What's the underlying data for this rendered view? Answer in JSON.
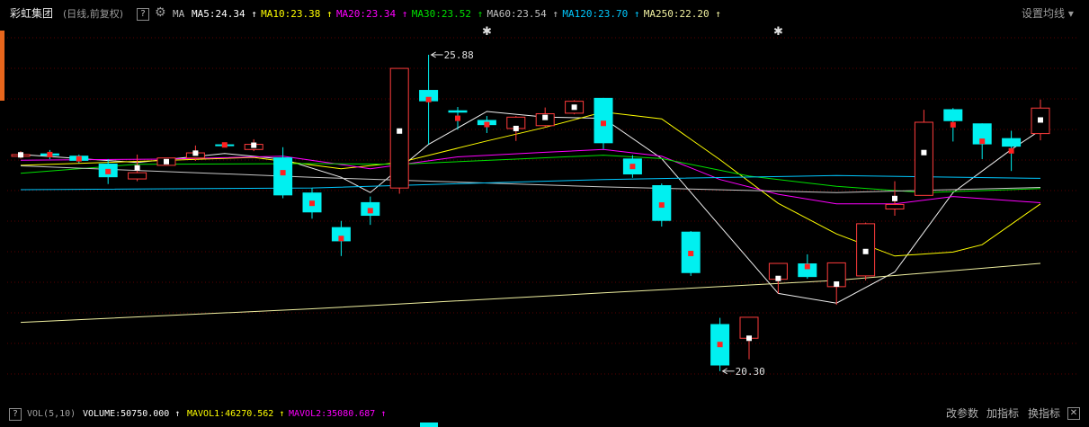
{
  "header": {
    "stock_name": "彩虹集团",
    "period_info": "(日线,前复权)",
    "help_label": "?",
    "ma_label": "MA",
    "settings_label": "设置均线"
  },
  "ma_legend": [
    {
      "text": "MA5:24.34",
      "color": "#ffffff"
    },
    {
      "text": "MA10:23.38",
      "color": "#ffff00"
    },
    {
      "text": "MA20:23.34",
      "color": "#ff00ff"
    },
    {
      "text": "MA30:23.52",
      "color": "#00e000"
    },
    {
      "text": "MA60:23.54",
      "color": "#c0c0c0"
    },
    {
      "text": "MA120:23.70",
      "color": "#00c8ff"
    },
    {
      "text": "MA250:22.20",
      "color": "#f0f0a0"
    }
  ],
  "footer": {
    "help_label": "?",
    "vol_label": "VOL(5,10)",
    "volume_text": "VOLUME:50750.000",
    "mavol1_text": "MAVOL1:46270.562",
    "mavol2_text": "MAVOL2:35080.687",
    "change_params": "改参数",
    "add_indicator": "加指标",
    "switch_indicator": "换指标"
  },
  "chart_data": {
    "type": "candlestick",
    "ylim": [
      19.79,
      26.45
    ],
    "grid": true,
    "colors": {
      "up": "#ff3c3c",
      "down": "#00f0f0",
      "mid_down": "#ff2020",
      "mid_up": "#ffffff"
    },
    "annotations": [
      {
        "label": "25.88",
        "candle_index": 14,
        "price": 25.88,
        "kind": "high"
      },
      {
        "label": "20.30",
        "candle_index": 24,
        "price": 20.3,
        "kind": "low"
      }
    ],
    "star_markers": [
      16,
      26
    ],
    "candles": [
      {
        "o": 24.11,
        "h": 24.18,
        "l": 24.05,
        "c": 24.12
      },
      {
        "o": 24.14,
        "h": 24.2,
        "l": 24.04,
        "c": 24.1
      },
      {
        "o": 24.1,
        "h": 24.12,
        "l": 23.97,
        "c": 24.01
      },
      {
        "o": 23.96,
        "h": 24.04,
        "l": 23.6,
        "c": 23.72
      },
      {
        "o": 23.69,
        "h": 24.12,
        "l": 23.65,
        "c": 23.8
      },
      {
        "o": 23.93,
        "h": 24.06,
        "l": 23.93,
        "c": 24.06
      },
      {
        "o": 24.06,
        "h": 24.28,
        "l": 24.01,
        "c": 24.15
      },
      {
        "o": 24.3,
        "h": 24.33,
        "l": 24.25,
        "c": 24.27
      },
      {
        "o": 24.21,
        "h": 24.39,
        "l": 24.18,
        "c": 24.3
      },
      {
        "o": 24.07,
        "h": 24.25,
        "l": 23.35,
        "c": 23.4
      },
      {
        "o": 23.45,
        "h": 23.53,
        "l": 22.99,
        "c": 23.1
      },
      {
        "o": 22.84,
        "h": 22.95,
        "l": 22.33,
        "c": 22.59
      },
      {
        "o": 23.28,
        "h": 23.38,
        "l": 22.88,
        "c": 23.04
      },
      {
        "o": 23.53,
        "h": 25.64,
        "l": 23.43,
        "c": 25.64
      },
      {
        "o": 25.26,
        "h": 25.88,
        "l": 24.3,
        "c": 25.06
      },
      {
        "o": 24.9,
        "h": 24.96,
        "l": 24.56,
        "c": 24.86
      },
      {
        "o": 24.73,
        "h": 24.8,
        "l": 24.5,
        "c": 24.64
      },
      {
        "o": 24.58,
        "h": 24.8,
        "l": 24.36,
        "c": 24.78
      },
      {
        "o": 24.63,
        "h": 24.95,
        "l": 24.6,
        "c": 24.84
      },
      {
        "o": 24.85,
        "h": 25.08,
        "l": 24.83,
        "c": 25.06
      },
      {
        "o": 25.12,
        "h": 25.12,
        "l": 24.22,
        "c": 24.32
      },
      {
        "o": 24.05,
        "h": 24.11,
        "l": 23.71,
        "c": 23.77
      },
      {
        "o": 23.58,
        "h": 23.61,
        "l": 22.85,
        "c": 22.95
      },
      {
        "o": 22.76,
        "h": 22.77,
        "l": 21.98,
        "c": 22.03
      },
      {
        "o": 21.13,
        "h": 21.24,
        "l": 20.3,
        "c": 20.4
      },
      {
        "o": 20.88,
        "h": 21.25,
        "l": 20.51,
        "c": 21.25
      },
      {
        "o": 21.92,
        "h": 22.2,
        "l": 21.67,
        "c": 22.2
      },
      {
        "o": 22.2,
        "h": 22.36,
        "l": 21.93,
        "c": 21.96
      },
      {
        "o": 21.79,
        "h": 22.2,
        "l": 21.47,
        "c": 22.21
      },
      {
        "o": 21.98,
        "h": 22.92,
        "l": 21.9,
        "c": 22.9
      },
      {
        "o": 23.16,
        "h": 23.65,
        "l": 23.04,
        "c": 23.24
      },
      {
        "o": 23.4,
        "h": 24.91,
        "l": 23.4,
        "c": 24.69
      },
      {
        "o": 24.92,
        "h": 24.94,
        "l": 24.35,
        "c": 24.71
      },
      {
        "o": 24.67,
        "h": 24.67,
        "l": 24.04,
        "c": 24.3
      },
      {
        "o": 24.41,
        "h": 24.54,
        "l": 23.83,
        "c": 24.26
      },
      {
        "o": 24.49,
        "h": 25.09,
        "l": 24.37,
        "c": 24.94
      }
    ],
    "ma_series": [
      {
        "key": "MA5",
        "color": "#f0f0f0",
        "points": [
          [
            0,
            24.12
          ],
          [
            4,
            23.98
          ],
          [
            7,
            24.14
          ],
          [
            9,
            24.04
          ],
          [
            11,
            23.72
          ],
          [
            12,
            23.45
          ],
          [
            14,
            24.3
          ],
          [
            16,
            24.88
          ],
          [
            18,
            24.78
          ],
          [
            20,
            24.76
          ],
          [
            22,
            24.05
          ],
          [
            24,
            22.86
          ],
          [
            26,
            21.67
          ],
          [
            28,
            21.5
          ],
          [
            30,
            22.05
          ],
          [
            32,
            23.45
          ],
          [
            34,
            24.21
          ],
          [
            35,
            24.55
          ]
        ]
      },
      {
        "key": "MA10",
        "color": "#ffff00",
        "points": [
          [
            0,
            23.93
          ],
          [
            4,
            24.0
          ],
          [
            8,
            24.07
          ],
          [
            11,
            23.87
          ],
          [
            13,
            23.98
          ],
          [
            16,
            24.36
          ],
          [
            18,
            24.6
          ],
          [
            20,
            24.87
          ],
          [
            22,
            24.75
          ],
          [
            24,
            24.03
          ],
          [
            26,
            23.26
          ],
          [
            28,
            22.72
          ],
          [
            30,
            22.33
          ],
          [
            32,
            22.4
          ],
          [
            33,
            22.53
          ],
          [
            35,
            23.25
          ]
        ]
      },
      {
        "key": "MA20",
        "color": "#ff00ff",
        "points": [
          [
            0,
            24.02
          ],
          [
            5,
            24.04
          ],
          [
            9,
            24.09
          ],
          [
            12,
            23.87
          ],
          [
            15,
            24.08
          ],
          [
            18,
            24.16
          ],
          [
            20,
            24.21
          ],
          [
            22,
            24.09
          ],
          [
            24,
            23.68
          ],
          [
            26,
            23.42
          ],
          [
            28,
            23.25
          ],
          [
            30,
            23.25
          ],
          [
            32,
            23.38
          ],
          [
            35,
            23.27
          ]
        ]
      },
      {
        "key": "MA30",
        "color": "#00e000",
        "points": [
          [
            0,
            23.79
          ],
          [
            4,
            23.95
          ],
          [
            10,
            23.96
          ],
          [
            13,
            23.95
          ],
          [
            17,
            24.04
          ],
          [
            20,
            24.11
          ],
          [
            22,
            24.05
          ],
          [
            25,
            23.74
          ],
          [
            28,
            23.56
          ],
          [
            31,
            23.45
          ],
          [
            35,
            23.52
          ]
        ]
      },
      {
        "key": "MA60",
        "color": "#c8c8c8",
        "points": [
          [
            0,
            23.92
          ],
          [
            10,
            23.72
          ],
          [
            20,
            23.55
          ],
          [
            28,
            23.45
          ],
          [
            35,
            23.54
          ]
        ]
      },
      {
        "key": "MA120",
        "color": "#00c8ff",
        "points": [
          [
            0,
            23.5
          ],
          [
            10,
            23.53
          ],
          [
            20,
            23.68
          ],
          [
            28,
            23.75
          ],
          [
            35,
            23.7
          ]
        ]
      },
      {
        "key": "MA250",
        "color": "#f0f0a0",
        "points": [
          [
            0,
            21.16
          ],
          [
            10,
            21.4
          ],
          [
            20,
            21.68
          ],
          [
            28,
            21.9
          ],
          [
            35,
            22.2
          ]
        ]
      }
    ]
  }
}
